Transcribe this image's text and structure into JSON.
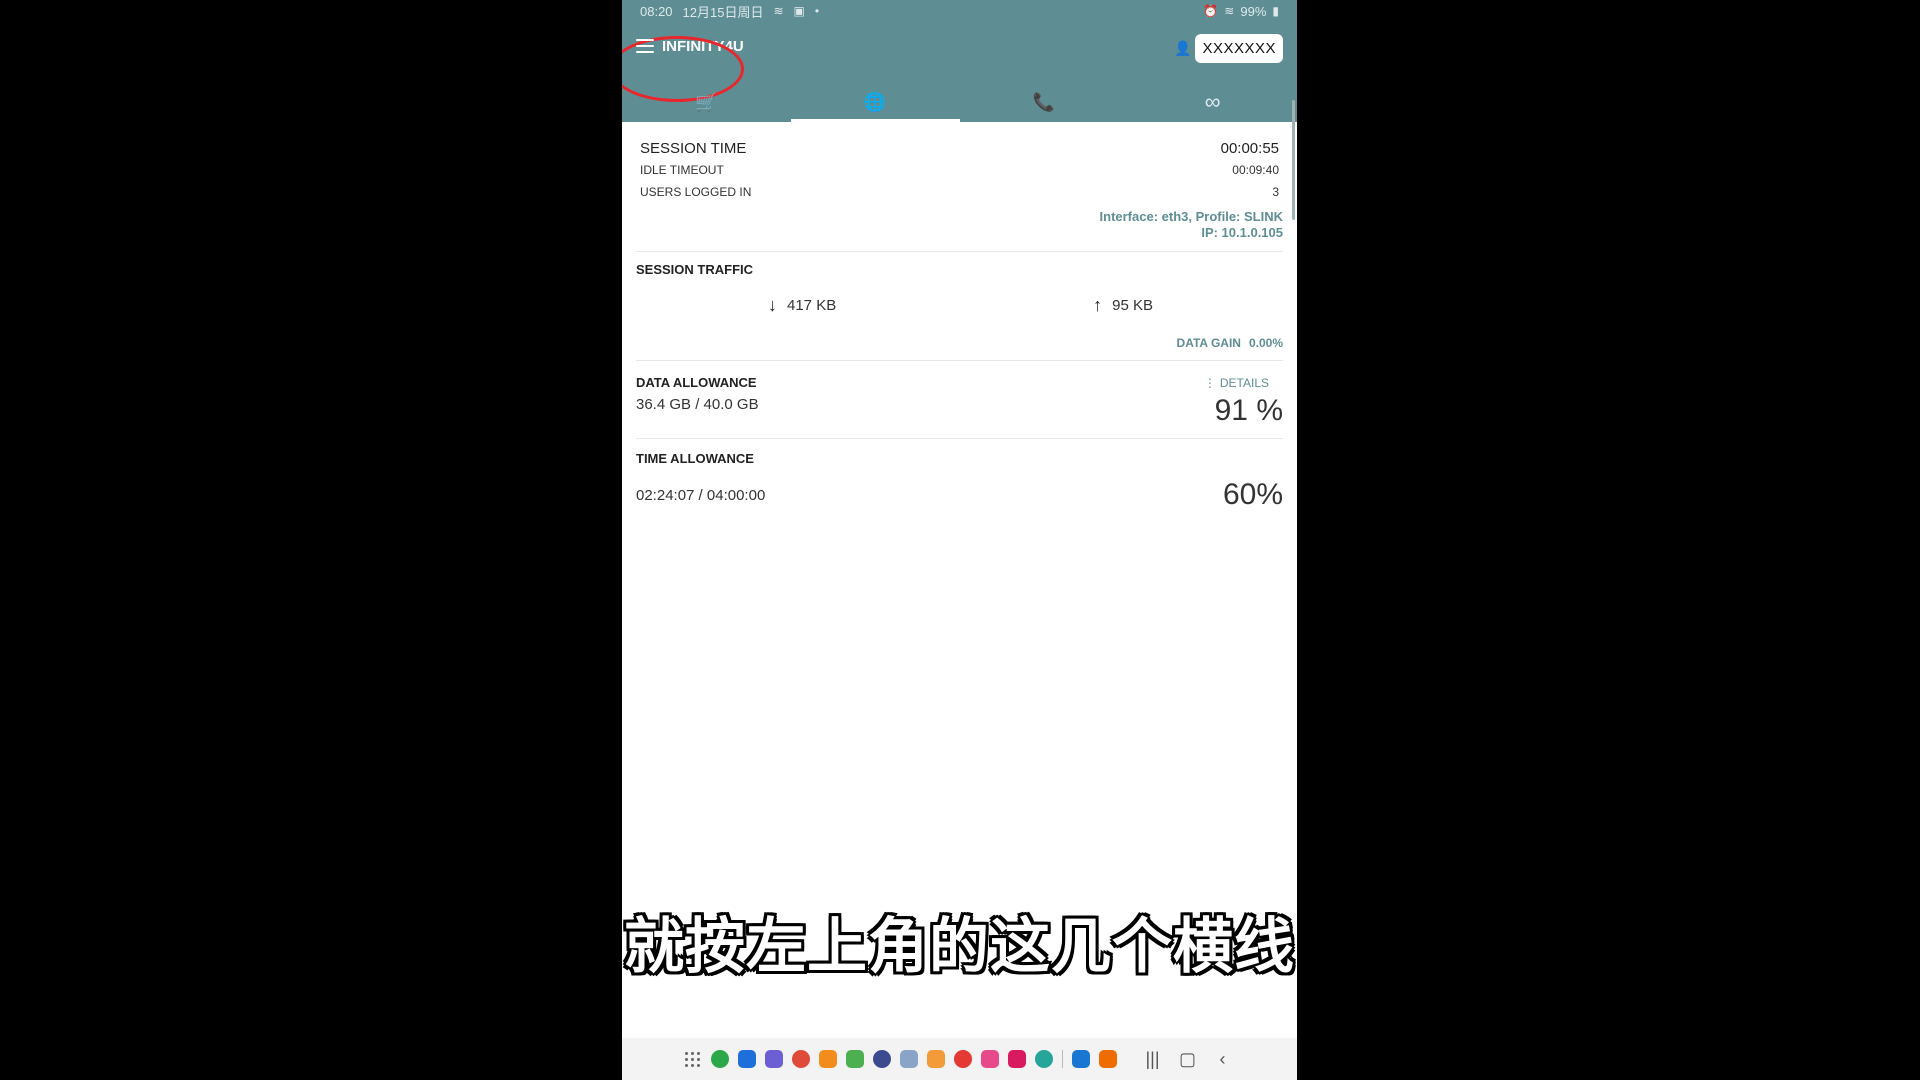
{
  "status_bar": {
    "time": "08:20",
    "date": "12月15日周日",
    "battery": "99%"
  },
  "header": {
    "brand": "INFINITY4U",
    "username": "XXXXXXX"
  },
  "tabs": [
    {
      "icon": "cart-icon",
      "glyph": "🛒"
    },
    {
      "icon": "globe-icon",
      "glyph": "🌐"
    },
    {
      "icon": "phone-icon",
      "glyph": "📞"
    },
    {
      "icon": "infinity-icon",
      "glyph": "∞"
    }
  ],
  "session": {
    "time_label": "SESSION TIME",
    "time_value": "00:00:55",
    "idle_label": "IDLE TIMEOUT",
    "idle_value": "00:09:40",
    "users_label": "USERS LOGGED IN",
    "users_value": "3",
    "interface_line": "Interface: eth3, Profile: SLINK",
    "ip_line": "IP: 10.1.0.105"
  },
  "traffic": {
    "title": "SESSION TRAFFIC",
    "download": "417 KB",
    "upload": "95 KB",
    "gain_label": "DATA GAIN",
    "gain_value": "0.00%"
  },
  "data_allowance": {
    "title": "DATA ALLOWANCE",
    "details_label": "DETAILS",
    "amount": "36.4 GB / 40.0 GB",
    "percent": "91 %"
  },
  "time_allowance": {
    "title": "TIME ALLOWANCE",
    "amount": "02:24:07 / 04:00:00",
    "percent": "60%"
  },
  "subtitle": "就按左上角的这几个横线",
  "colors": {
    "accent": "#5e8e94",
    "annotation_circle": "#e8262b"
  },
  "dock_apps": [
    "#2aa84a",
    "#1e6fd9",
    "#6b5fd3",
    "#e04a3a",
    "#f28c1c",
    "#4caf50",
    "#3c4b8f",
    "#8aa4c8",
    "#f29b38",
    "#e53935",
    "#e64a8a",
    "#d81b60",
    "#26a69a",
    "#1976d2",
    "#ef6c00"
  ]
}
